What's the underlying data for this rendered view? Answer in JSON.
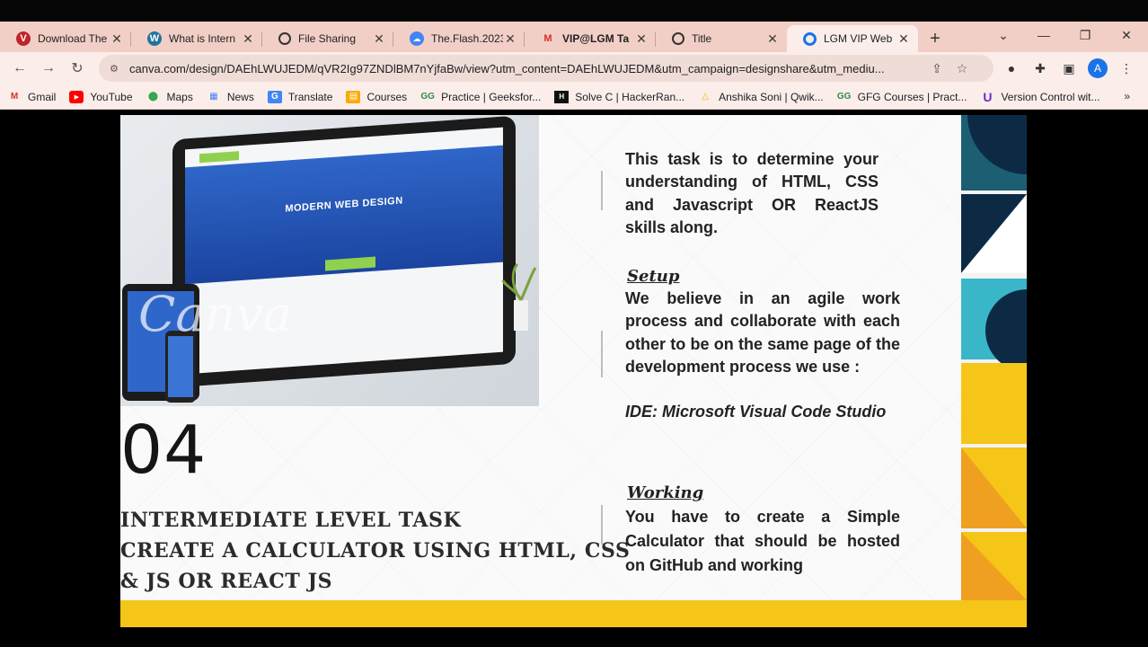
{
  "tabs": [
    {
      "title": "Download The",
      "icon": "vivaldi-icon",
      "color": "#c0232c"
    },
    {
      "title": "What is Intern",
      "icon": "wordpress-icon",
      "color": "#21759b"
    },
    {
      "title": "File Sharing",
      "icon": "globe-icon",
      "color": "#333333"
    },
    {
      "title": "The.Flash.2023",
      "icon": "cloud-icon",
      "color": "#4285f4"
    },
    {
      "title": "VIP@LGM Ta",
      "icon": "gmail-icon",
      "color": "#d93025"
    },
    {
      "title": "Title",
      "icon": "globe-icon",
      "color": "#333333"
    },
    {
      "title": "LGM VIP Web",
      "icon": "chrome-icon",
      "color": "#1a73e8"
    }
  ],
  "address_bar": {
    "url": "canva.com/design/DAEhLWUJEDM/qVR2Ig97ZNDlBM7nYjfaBw/view?utm_content=DAEhLWUJEDM&utm_campaign=designshare&utm_mediu..."
  },
  "bookmarks": [
    {
      "label": "Gmail",
      "icon": "gmail-icon"
    },
    {
      "label": "YouTube",
      "icon": "youtube-icon"
    },
    {
      "label": "Maps",
      "icon": "maps-icon"
    },
    {
      "label": "News",
      "icon": "news-icon"
    },
    {
      "label": "Translate",
      "icon": "translate-icon"
    },
    {
      "label": "Courses",
      "icon": "courses-icon"
    },
    {
      "label": "Practice | Geeksfor...",
      "icon": "gfg-icon"
    },
    {
      "label": "Solve C | HackerRan...",
      "icon": "hackerrank-icon"
    },
    {
      "label": "Anshika Soni | Qwik...",
      "icon": "qwiklabs-icon"
    },
    {
      "label": "GFG Courses | Pract...",
      "icon": "gfg-icon"
    },
    {
      "label": "Version Control wit...",
      "icon": "udacity-icon"
    }
  ],
  "profile_initial": "A",
  "slide": {
    "image_hero_text": "MODERN WEB DESIGN",
    "image_watermark": "Canva",
    "number": "04",
    "title_lines": [
      "INTERMEDIATE LEVEL TASK",
      "CREATE A CALCULATOR USING HTML, CSS",
      "& JS OR REACT JS"
    ],
    "intro": "This task is to determine your understanding of HTML, CSS and Javascript OR ReactJS skills along.",
    "setup_heading": "Setup",
    "setup_body": "We believe in an agile work process and collaborate with each other to be on the same page of the development process we use :",
    "ide": "IDE: Microsoft Visual Code Studio",
    "working_heading": "Working",
    "working_body": "You have to create a Simple Calculator that should be hosted on GitHub and working"
  },
  "colors": {
    "tab_strip": "#f2cfc6",
    "toolbar": "#fbeeea",
    "accent_yellow": "#f5c518",
    "navy": "#0d2a45"
  }
}
